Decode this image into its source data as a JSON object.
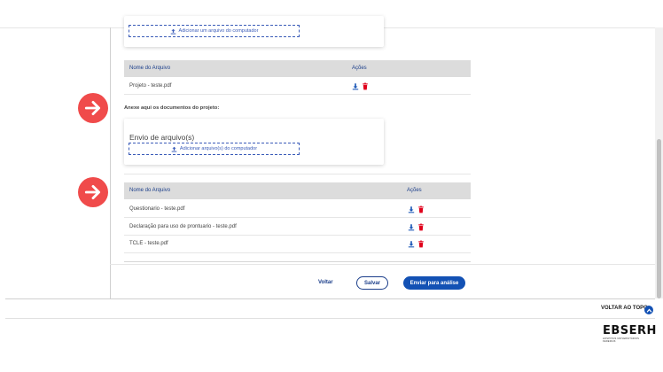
{
  "upload_card_top": {
    "button_label": "Adicionar um arquivo do computador"
  },
  "table1": {
    "headers": {
      "name": "Nome do Arquivo",
      "actions": "Ações"
    },
    "rows": [
      "Projeto - teste.pdf"
    ]
  },
  "docs_section": {
    "label": "Anexe aqui os documentos do projeto:",
    "title": "Envio de arquivo(s)",
    "button_label": "Adicionar arquivo(s) do computador"
  },
  "table2": {
    "headers": {
      "name": "Nome do Arquivo",
      "actions": "Ações"
    },
    "rows": [
      "Questionario - teste.pdf",
      "Declaração para uso de prontuario - teste.pdf",
      "TCLE - teste.pdf"
    ]
  },
  "actions": {
    "back": "Voltar",
    "save": "Salvar",
    "submit": "Enviar para análise"
  },
  "footer": {
    "back_to_top": "VOLTAR AO TOPO",
    "logo_text": "EBSERH",
    "logo_sub": "HOSPITAIS UNIVERSITÁRIOS FEDERAIS"
  },
  "colors": {
    "accent": "#1351b4",
    "arrow": "#f04b4b",
    "delete": "#e0001b"
  },
  "icons": [
    "upload-icon",
    "download-icon",
    "trash-icon",
    "arrow-right-icon",
    "chevron-up-icon"
  ]
}
